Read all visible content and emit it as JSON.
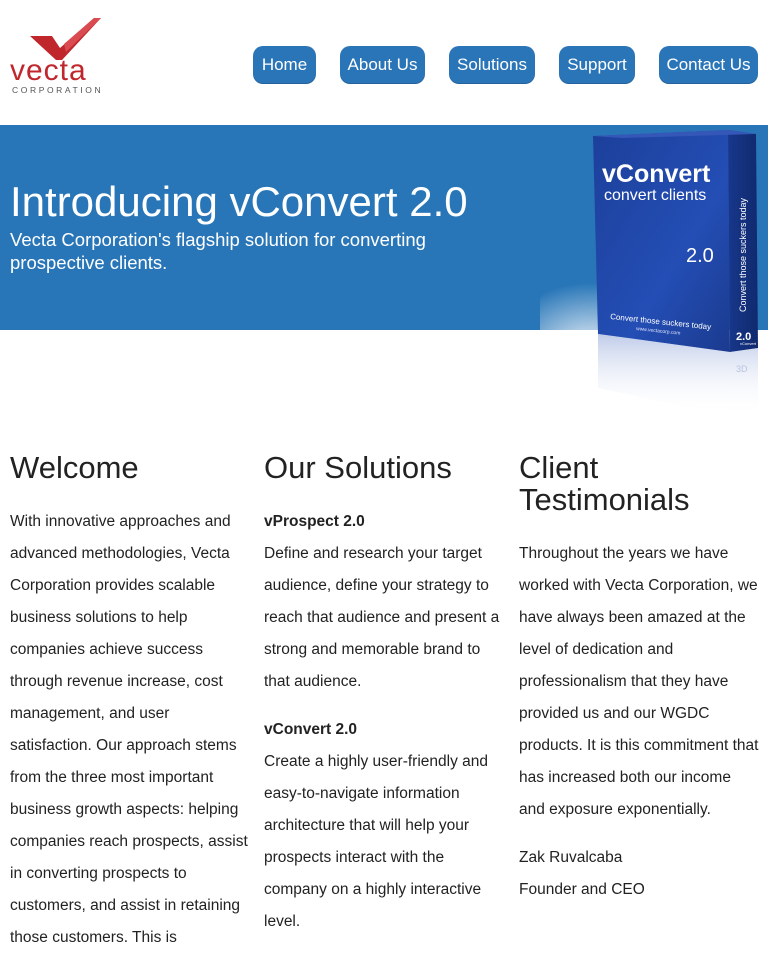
{
  "logo": {
    "word": "vecta",
    "sub": "CORPORATION"
  },
  "nav": {
    "items": [
      {
        "label": "Home"
      },
      {
        "label": "About Us"
      },
      {
        "label": "Solutions"
      },
      {
        "label": "Support"
      },
      {
        "label": "Contact Us"
      }
    ]
  },
  "hero": {
    "title": "Introducing vConvert 2.0",
    "subtitle": "Vecta Corporation's flagship solution for converting prospective clients."
  },
  "product_box": {
    "name": "vConvert",
    "tagline": "convert clients",
    "version": "2.0",
    "slogan": "Convert those suckers today",
    "url": "www.vectacorp.com",
    "side_text": "Convert those suckers today",
    "side_version": "2.0",
    "side_name": "vConvert",
    "reflection": "3D"
  },
  "welcome": {
    "heading": "Welcome",
    "body": "With innovative approaches and advanced methodologies, Vecta Corporation provides scalable business solutions to help companies achieve success through revenue increase, cost management, and user satisfaction. Our approach stems from the three most important business growth aspects: helping companies reach prospects, assist in converting prospects to customers, and assist in retaining those customers. This is"
  },
  "solutions": {
    "heading": "Our Solutions",
    "items": [
      {
        "name": "vProspect 2.0",
        "desc": "Define and research your target audience, define your strategy to reach that audience and present a strong and memorable brand to that audience."
      },
      {
        "name": "vConvert 2.0",
        "desc": "Create a highly user-friendly and easy-to-navigate information architecture that will help your prospects interact with the company on a highly interactive level."
      }
    ]
  },
  "testimonials": {
    "heading": "Client Testimonials",
    "quote": "Throughout the years we have worked with Vecta Corporation, we have always been amazed at the level of dedication and professionalism that they have provided us and our WGDC products. It is this commitment that has increased both our income and exposure exponentially.",
    "author": "Zak Ruvalcaba",
    "role": "Founder and CEO"
  },
  "colors": {
    "brand_blue": "#2876b8",
    "nav_blue": "#2a74b8",
    "logo_red": "#c0272d"
  }
}
